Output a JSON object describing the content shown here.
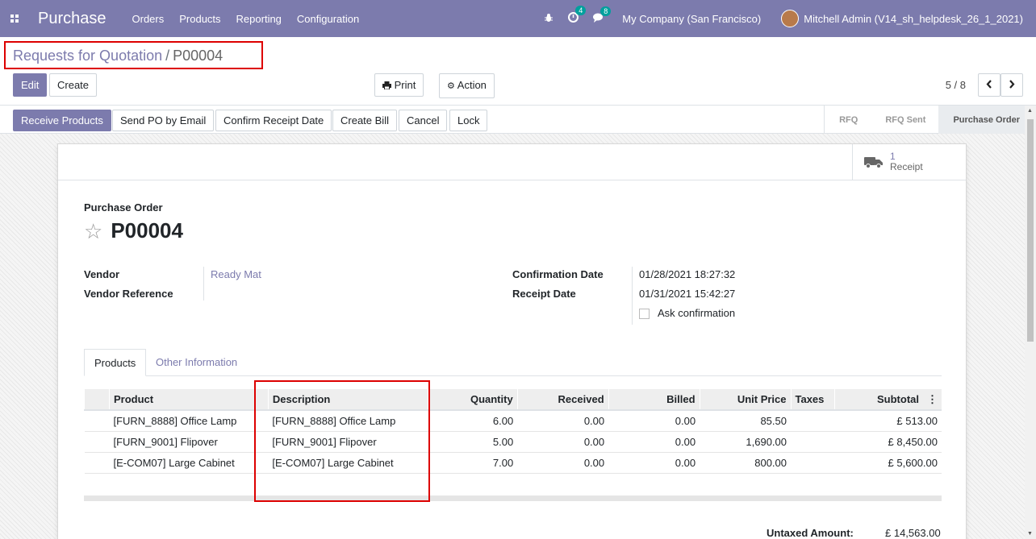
{
  "navbar": {
    "app_name": "Purchase",
    "menu": [
      "Orders",
      "Products",
      "Reporting",
      "Configuration"
    ],
    "activity_count": "4",
    "message_count": "8",
    "company": "My Company (San Francisco)",
    "user": "Mitchell Admin (V14_sh_helpdesk_26_1_2021)"
  },
  "breadcrumb": {
    "parent": "Requests for Quotation",
    "separator": "/",
    "current": "P00004"
  },
  "control": {
    "edit": "Edit",
    "create": "Create",
    "print": "Print",
    "action": "Action",
    "pager": "5 / 8"
  },
  "status_buttons": [
    "Receive Products",
    "Send PO by Email",
    "Confirm Receipt Date",
    "Create Bill",
    "Cancel",
    "Lock"
  ],
  "stages": [
    "RFQ",
    "RFQ Sent",
    "Purchase Order"
  ],
  "smart_button": {
    "count": "1",
    "label": "Receipt"
  },
  "form": {
    "type_label": "Purchase Order",
    "name": "P00004",
    "vendor_label": "Vendor",
    "vendor_value": "Ready Mat",
    "vendor_ref_label": "Vendor Reference",
    "confirmation_label": "Confirmation Date",
    "confirmation_value": "01/28/2021 18:27:32",
    "receipt_label": "Receipt Date",
    "receipt_value": "01/31/2021 15:42:27",
    "ask_confirmation": "Ask confirmation"
  },
  "tabs": [
    "Products",
    "Other Information"
  ],
  "table": {
    "headers": [
      "Product",
      "Description",
      "Quantity",
      "Received",
      "Billed",
      "Unit Price",
      "Taxes",
      "Subtotal"
    ],
    "rows": [
      [
        "[FURN_8888] Office Lamp",
        "[FURN_8888] Office Lamp",
        "6.00",
        "0.00",
        "0.00",
        "85.50",
        "",
        "£ 513.00"
      ],
      [
        "[FURN_9001] Flipover",
        "[FURN_9001] Flipover",
        "5.00",
        "0.00",
        "0.00",
        "1,690.00",
        "",
        "£ 8,450.00"
      ],
      [
        "[E-COM07] Large Cabinet",
        "[E-COM07] Large Cabinet",
        "7.00",
        "0.00",
        "0.00",
        "800.00",
        "",
        "£ 5,600.00"
      ]
    ]
  },
  "totals": {
    "untaxed_label": "Untaxed Amount:",
    "untaxed_value": "£ 14,563.00"
  },
  "colors": {
    "brand": "#7c7bad",
    "highlight": "#dd0000"
  }
}
